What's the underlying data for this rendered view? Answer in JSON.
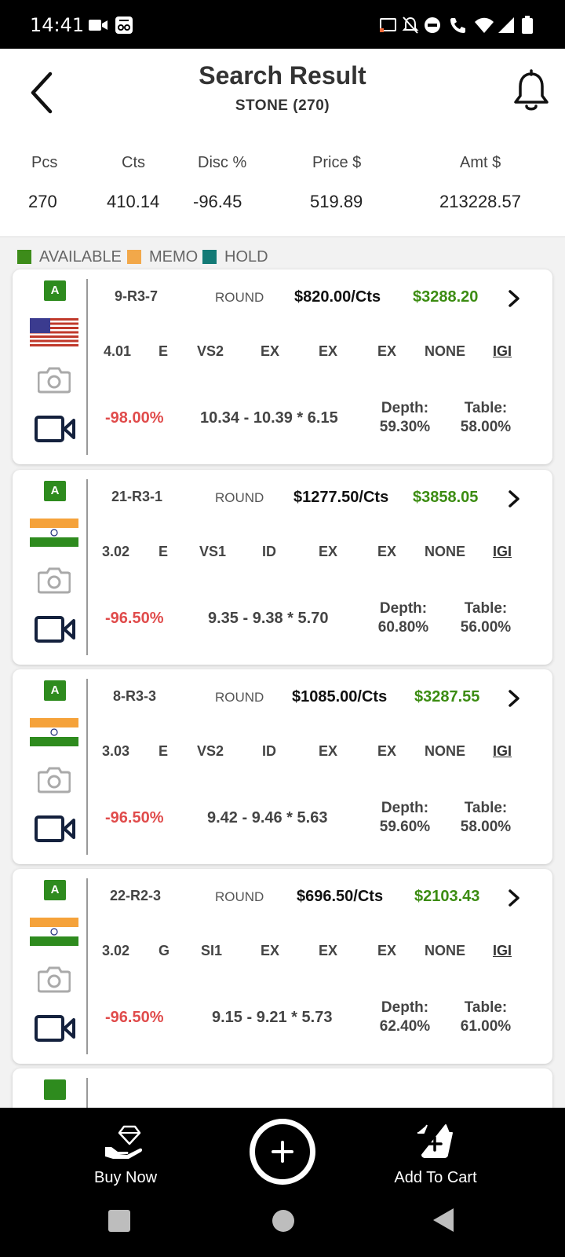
{
  "status_bar": {
    "time": "14:41"
  },
  "header": {
    "title": "Search Result",
    "subtitle": "STONE (270)"
  },
  "summary": {
    "labels": [
      "Pcs",
      "Cts",
      "Disc %",
      "Price $",
      "Amt $"
    ],
    "values": [
      "270",
      "410.14",
      "-96.45",
      "519.89",
      "213228.57"
    ]
  },
  "legend": [
    {
      "label": "AVAILABLE",
      "color": "#3d8c1a"
    },
    {
      "label": "MEMO",
      "color": "#f2a84a"
    },
    {
      "label": "HOLD",
      "color": "#137a76"
    }
  ],
  "stones": [
    {
      "badge": "A",
      "flag": "us-flag",
      "id": "9-R3-7",
      "shape": "ROUND",
      "price_per_ct": "$820.00/Cts",
      "amount": "$3288.20",
      "carat": "4.01",
      "color": "E",
      "clarity": "VS2",
      "cut": "EX",
      "polish": "EX",
      "symmetry": "EX",
      "fluorescence": "NONE",
      "lab": "IGI",
      "discount": "-98.00%",
      "measurements": "10.34 - 10.39 * 6.15",
      "depth_label": "Depth:",
      "depth": "59.30%",
      "table_label": "Table:",
      "table": "58.00%"
    },
    {
      "badge": "A",
      "flag": "india-flag",
      "id": "21-R3-1",
      "shape": "ROUND",
      "price_per_ct": "$1277.50/Cts",
      "amount": "$3858.05",
      "carat": "3.02",
      "color": "E",
      "clarity": "VS1",
      "cut": "ID",
      "polish": "EX",
      "symmetry": "EX",
      "fluorescence": "NONE",
      "lab": "IGI",
      "discount": "-96.50%",
      "measurements": "9.35 - 9.38 * 5.70",
      "depth_label": "Depth:",
      "depth": "60.80%",
      "table_label": "Table:",
      "table": "56.00%"
    },
    {
      "badge": "A",
      "flag": "india-flag",
      "id": "8-R3-3",
      "shape": "ROUND",
      "price_per_ct": "$1085.00/Cts",
      "amount": "$3287.55",
      "carat": "3.03",
      "color": "E",
      "clarity": "VS2",
      "cut": "ID",
      "polish": "EX",
      "symmetry": "EX",
      "fluorescence": "NONE",
      "lab": "IGI",
      "discount": "-96.50%",
      "measurements": "9.42 - 9.46 * 5.63",
      "depth_label": "Depth:",
      "depth": "59.60%",
      "table_label": "Table:",
      "table": "58.00%"
    },
    {
      "badge": "A",
      "flag": "india-flag",
      "id": "22-R2-3",
      "shape": "ROUND",
      "price_per_ct": "$696.50/Cts",
      "amount": "$2103.43",
      "carat": "3.02",
      "color": "G",
      "clarity": "SI1",
      "cut": "EX",
      "polish": "EX",
      "symmetry": "EX",
      "fluorescence": "NONE",
      "lab": "IGI",
      "discount": "-96.50%",
      "measurements": "9.15 - 9.21 * 5.73",
      "depth_label": "Depth:",
      "depth": "62.40%",
      "table_label": "Table:",
      "table": "61.00%"
    }
  ],
  "bottom_bar": {
    "buy_now": "Buy Now",
    "add_to_cart": "Add To Cart"
  }
}
